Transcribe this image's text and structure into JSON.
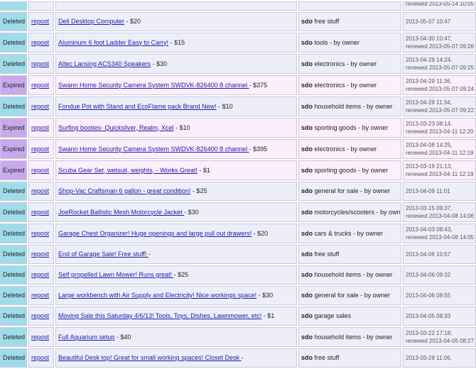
{
  "repost_label": "repost",
  "rows": [
    {
      "status": "",
      "title": "",
      "price": "",
      "area": "",
      "category": "",
      "posted": "",
      "renewed": "renewed 2013-05-14 10:05"
    },
    {
      "status": "Deleted",
      "title": "Dell Desktop Computer",
      "price": " - $20",
      "area": "sdo",
      "category": "free stuff",
      "posted": "2013-05-07 10:47",
      "renewed": ""
    },
    {
      "status": "Deleted",
      "title": "Aluminum 6 foot Ladder Easy to Carry!",
      "price": " - $15",
      "area": "sdo",
      "category": "tools - by owner",
      "posted": "2013-04-30 10:47,",
      "renewed": "renewed 2013-05-07 09:26"
    },
    {
      "status": "Deleted",
      "title": "Altec Lansing ACS340 Speakers",
      "price": " - $30",
      "area": "sdo",
      "category": "electronics - by owner",
      "posted": "2013-04-29 14:24,",
      "renewed": "renewed 2013-05-07 09:25"
    },
    {
      "status": "Expired",
      "title": "Swann Home Security Camera System SWDVK-826400 8 channel ",
      "price": " - $375",
      "area": "sdo",
      "category": "electronics - by owner",
      "posted": "2013-04-29 11:36,",
      "renewed": "renewed 2013-05-07 09:24"
    },
    {
      "status": "Deleted",
      "title": "Fondue Pot with Stand and EcoFlame pack Brand New!",
      "price": " - $10",
      "area": "sdo",
      "category": "household items - by owner",
      "posted": "2013-04-29 11:34,",
      "renewed": "renewed 2013-05-07 09:22"
    },
    {
      "status": "Expired",
      "title": "Surfing booties- Quicksilver, Realm, Xcel",
      "price": " - $10",
      "area": "sdo",
      "category": "sporting goods - by owner",
      "posted": "2013-03-23 08:14,",
      "renewed": "renewed 2013-04-11 12:20"
    },
    {
      "status": "Expired",
      "title": "Swann Home Security Camera System SWDVK-826400 8 channel ",
      "price": " - $395",
      "area": "sdo",
      "category": "electronics - by owner",
      "posted": "2013-04-08 14:25,",
      "renewed": "renewed 2013-04-11 12:19"
    },
    {
      "status": "Expired",
      "title": "Scuba Gear Set, wetsuit, weights, - Works Great!",
      "price": " - $1",
      "area": "sdo",
      "category": "sporting goods - by owner",
      "posted": "2013-03-19 21:13,",
      "renewed": "renewed 2013-04-11 12:19"
    },
    {
      "status": "Deleted",
      "title": "Shop-Vac Craftsman 6 gallon - great condition!",
      "price": " - $25",
      "area": "sdo",
      "category": "general for sale - by owner",
      "posted": "2013-04-09 11:01",
      "renewed": ""
    },
    {
      "status": "Deleted",
      "title": "JoeRocket Ballistic Mesh Motorcycle Jacket ",
      "price": " - $30",
      "area": "sdo",
      "category": "motorcycles/scooters - by owner",
      "posted": "2013-03-15 09:37,",
      "renewed": "renewed 2013-04-08 14:06"
    },
    {
      "status": "Deleted",
      "title": "Garage Chest Organizer! Huge openings and large pull out drawers!",
      "price": " - $20",
      "area": "sdo",
      "category": "cars & trucks - by owner",
      "posted": "2013-04-03 08:43,",
      "renewed": "renewed 2013-04-08 14:05"
    },
    {
      "status": "Deleted",
      "title": "End of Garage Sale! Free stuff! ",
      "price": " - ",
      "area": "sdo",
      "category": "free stuff",
      "posted": "2013-04-06 10:57",
      "renewed": ""
    },
    {
      "status": "Deleted",
      "title": "Self propelled Lawn Mower! Runs great! ",
      "price": " - $25",
      "area": "sdo",
      "category": "household items - by owner",
      "posted": "2013-04-06 09:32",
      "renewed": ""
    },
    {
      "status": "Deleted",
      "title": "Large workbench with Air Supply and Electricity! Nice workings space!",
      "price": " - $30",
      "area": "sdo",
      "category": "general for sale - by owner",
      "posted": "2013-04-06 08:55",
      "renewed": ""
    },
    {
      "status": "Deleted",
      "title": "Moving Sale this Saturday 4/6/13! Tools, Toys, Dishes, Lawnmower, etc!",
      "price": " - $1",
      "area": "sdo",
      "category": "garage sales",
      "posted": "2013-04-05 08:33",
      "renewed": ""
    },
    {
      "status": "Deleted",
      "title": "Full Aquarium setup",
      "price": " - $40",
      "area": "sdo",
      "category": "household items - by owner",
      "posted": "2013-03-22 17:18,",
      "renewed": "renewed 2013-04-05 08:27"
    },
    {
      "status": "Deleted",
      "title": "Beautiful Desk top! Great for small working spaces! Closet Desk ",
      "price": " - ",
      "area": "sdo",
      "category": "free stuff",
      "posted": "2013-03-29 11:06,",
      "renewed": ""
    }
  ]
}
